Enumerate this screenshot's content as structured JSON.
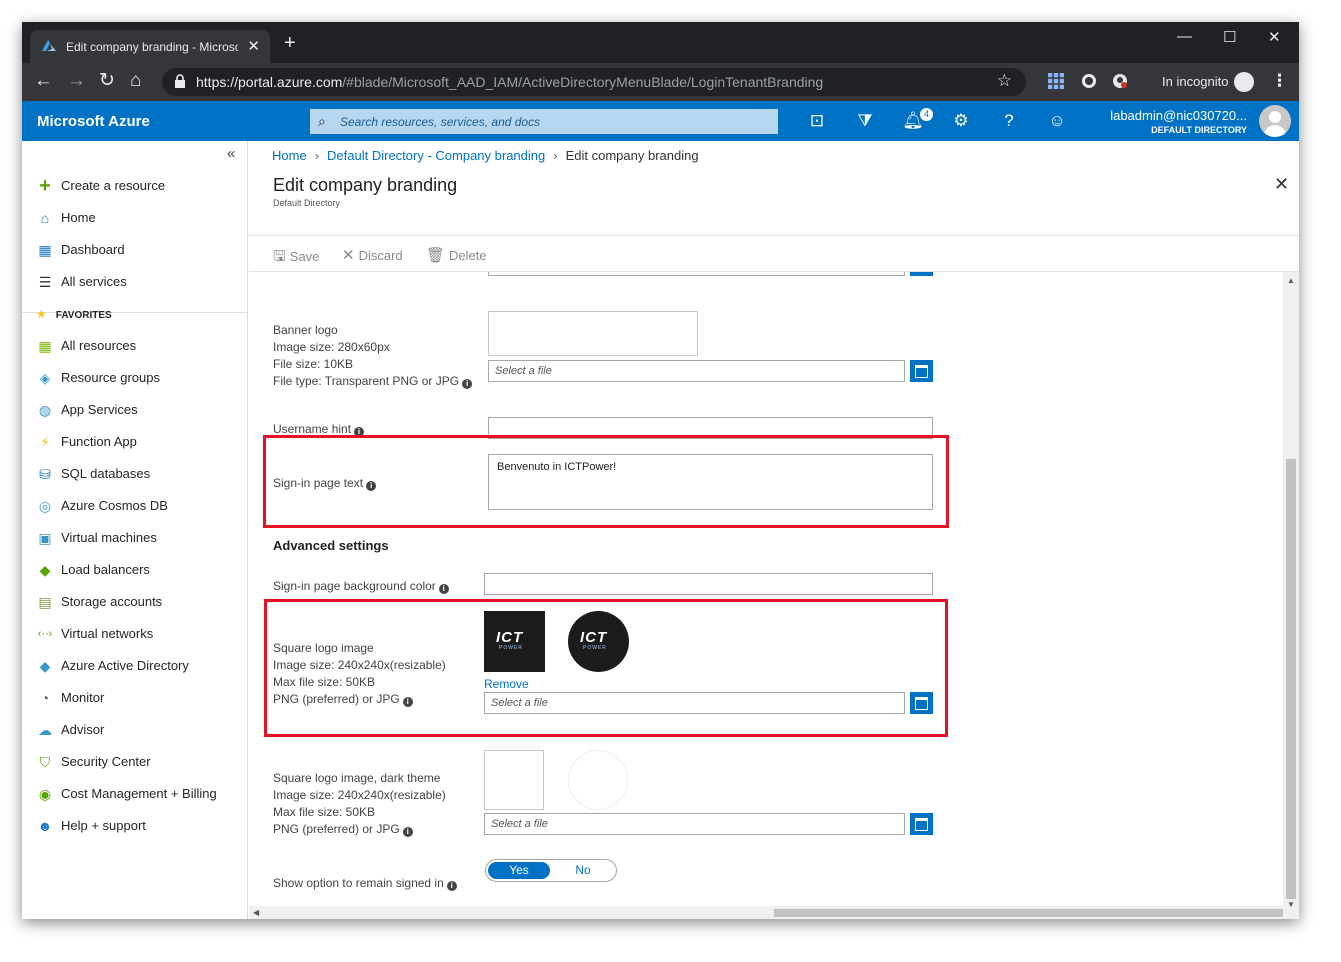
{
  "browser": {
    "tab_title": "Edit company branding - Microso",
    "url_host": "https://portal.azure.com",
    "url_path": "/#blade/Microsoft_AAD_IAM/ActiveDirectoryMenuBlade/LoginTenantBranding",
    "incognito_label": "In incognito"
  },
  "header": {
    "brand": "Microsoft Azure",
    "search_placeholder": "Search resources, services, and docs",
    "notification_count": "4",
    "user_name": "labadmin@nic030720...",
    "user_directory": "DEFAULT DIRECTORY",
    "accent_color": "#0072c6"
  },
  "sidebar": {
    "items": [
      {
        "label": "Create a resource",
        "icon": "plus-icon"
      },
      {
        "label": "Home",
        "icon": "home-icon"
      },
      {
        "label": "Dashboard",
        "icon": "dashboard-icon"
      },
      {
        "label": "All services",
        "icon": "list-icon"
      }
    ],
    "favorites_label": "FAVORITES",
    "favorites": [
      {
        "label": "All resources",
        "icon": "grid-icon"
      },
      {
        "label": "Resource groups",
        "icon": "cube-icon"
      },
      {
        "label": "App Services",
        "icon": "globe-icon"
      },
      {
        "label": "Function App",
        "icon": "bolt-icon"
      },
      {
        "label": "SQL databases",
        "icon": "database-icon"
      },
      {
        "label": "Azure Cosmos DB",
        "icon": "planet-icon"
      },
      {
        "label": "Virtual machines",
        "icon": "monitor-icon"
      },
      {
        "label": "Load balancers",
        "icon": "diamond-icon"
      },
      {
        "label": "Storage accounts",
        "icon": "storage-icon"
      },
      {
        "label": "Virtual networks",
        "icon": "network-icon"
      },
      {
        "label": "Azure Active Directory",
        "icon": "aad-icon"
      },
      {
        "label": "Monitor",
        "icon": "gauge-icon"
      },
      {
        "label": "Advisor",
        "icon": "cloud-icon"
      },
      {
        "label": "Security Center",
        "icon": "shield-icon"
      },
      {
        "label": "Cost Management + Billing",
        "icon": "cost-icon"
      },
      {
        "label": "Help + support",
        "icon": "person-icon"
      }
    ]
  },
  "breadcrumb": {
    "home": "Home",
    "parent": "Default Directory - Company branding",
    "current": "Edit company branding"
  },
  "blade": {
    "title": "Edit company branding",
    "subtitle": "Default Directory",
    "commands": {
      "save": "Save",
      "discard": "Discard",
      "delete": "Delete"
    }
  },
  "form": {
    "banner": {
      "lines": [
        "Banner logo",
        "Image size: 280x60px",
        "File size: 10KB",
        "File type: Transparent PNG or JPG"
      ],
      "file_placeholder": "Select a file"
    },
    "username_hint": {
      "label": "Username hint",
      "value": ""
    },
    "signin_text": {
      "label": "Sign-in page text",
      "value": "Benvenuto in ICTPower!"
    },
    "advanced_title": "Advanced settings",
    "bg_color": {
      "label": "Sign-in page background color",
      "value": ""
    },
    "square_logo": {
      "lines": [
        "Square logo image",
        "Image size: 240x240x(resizable)",
        "Max file size: 50KB",
        "PNG (preferred) or JPG"
      ],
      "logo_text": "ICT",
      "logo_subtext": "POWER",
      "remove_label": "Remove",
      "file_placeholder": "Select a file"
    },
    "square_logo_dark": {
      "lines": [
        "Square logo image, dark theme",
        "Image size: 240x240x(resizable)",
        "Max file size: 50KB",
        "PNG (preferred) or JPG"
      ],
      "file_placeholder": "Select a file"
    },
    "remain_signed": {
      "label": "Show option to remain signed in",
      "yes": "Yes",
      "no": "No",
      "selected": "Yes"
    }
  }
}
